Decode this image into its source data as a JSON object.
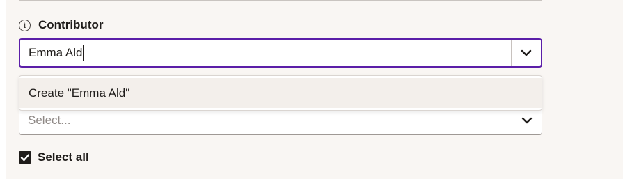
{
  "contributor_field": {
    "label": "Contributor",
    "info_icon_glyph": "i",
    "input_value": "Emma Ald",
    "toggle_icon": "chevron-down-icon"
  },
  "dropdown": {
    "options": [
      {
        "label": "Create \"Emma Ald\""
      }
    ]
  },
  "second_field": {
    "placeholder": "Select...",
    "toggle_icon": "chevron-down-icon"
  },
  "select_all": {
    "label": "Select all",
    "checked": true
  },
  "colors": {
    "focus_border": "#5b1ea8",
    "panel_background": "#f9f6f3",
    "text": "#1f1c1a"
  }
}
